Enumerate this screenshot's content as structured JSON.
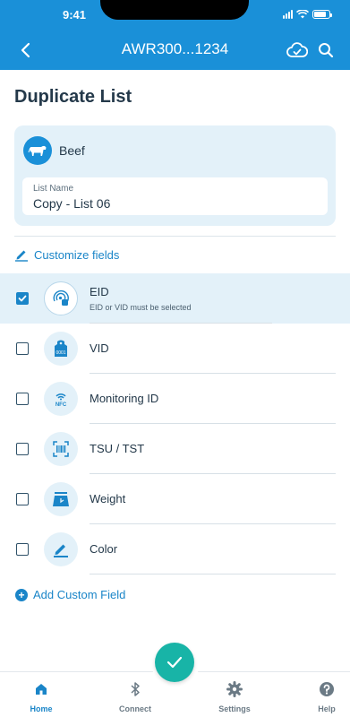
{
  "status_bar": {
    "time": "9:41"
  },
  "nav": {
    "title": "AWR300...1234"
  },
  "page": {
    "title": "Duplicate List"
  },
  "species": {
    "label": "Beef"
  },
  "list_name": {
    "label": "List Name",
    "value": "Copy - List 06"
  },
  "customize": {
    "label": "Customize fields"
  },
  "fields": [
    {
      "label": "EID",
      "sublabel": "EID or VID must be selected",
      "checked": true,
      "icon": "eid-icon"
    },
    {
      "label": "VID",
      "checked": false,
      "icon": "vid-tag-icon",
      "icon_text": "0001"
    },
    {
      "label": "Monitoring ID",
      "checked": false,
      "icon": "nfc-icon",
      "icon_text": "NFC"
    },
    {
      "label": "TSU / TST",
      "checked": false,
      "icon": "barcode-icon"
    },
    {
      "label": "Weight",
      "checked": false,
      "icon": "weight-icon"
    },
    {
      "label": "Color",
      "checked": false,
      "icon": "pen-icon"
    }
  ],
  "add_custom": {
    "label": "Add Custom Field"
  },
  "tabs": [
    {
      "label": "Home",
      "active": true
    },
    {
      "label": "Connect",
      "active": false
    },
    {
      "label": "Settings",
      "active": false
    },
    {
      "label": "Help",
      "active": false
    }
  ],
  "colors": {
    "primary": "#1a90d8",
    "accent": "#18b4a7",
    "card": "#e3f1f9",
    "text": "#24394a"
  }
}
